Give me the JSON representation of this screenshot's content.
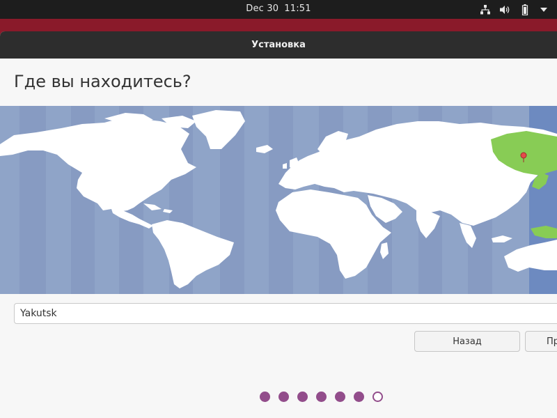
{
  "topbar": {
    "date": "Dec 30",
    "time": "11:51",
    "icons": [
      "network-icon",
      "volume-icon",
      "battery-icon",
      "system-menu-chevron-icon"
    ]
  },
  "window": {
    "title": "Установка"
  },
  "page": {
    "heading": "Где вы находитесь?"
  },
  "map": {
    "selected_region": "Yakutsk",
    "selected_color": "#88cc55",
    "land_color": "#ffffff",
    "ocean_color": "#8fa4c8",
    "highlight_band_color": "#6d8ac0",
    "pin_color": "#e44b4b"
  },
  "timezone": {
    "value": "Yakutsk"
  },
  "buttons": {
    "back_label": "Назад",
    "next_label": "Пр"
  },
  "progress": {
    "total_steps": 7,
    "completed_steps": 6,
    "accent_color": "#924d8b"
  }
}
